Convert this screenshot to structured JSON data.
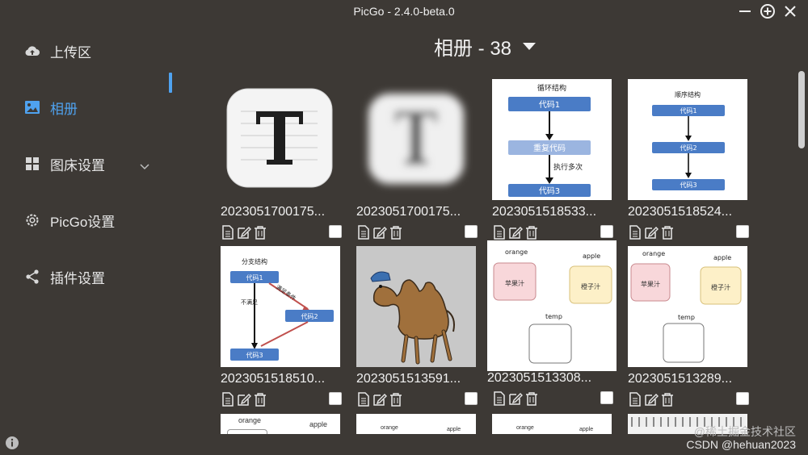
{
  "window": {
    "title": "PicGo - 2.4.0-beta.0"
  },
  "sidebar": {
    "items": [
      {
        "label": "上传区",
        "icon": "upload-cloud-icon"
      },
      {
        "label": "相册",
        "icon": "image-icon",
        "active": true
      },
      {
        "label": "图床设置",
        "icon": "grid-icon"
      },
      {
        "label": "PicGo设置",
        "icon": "gear-icon"
      },
      {
        "label": "插件设置",
        "icon": "share-icon"
      }
    ]
  },
  "album": {
    "title": "相册 - 38"
  },
  "gallery": {
    "items": [
      {
        "filename": "2023051700175...",
        "thumb": "typora-icon-sharp"
      },
      {
        "filename": "2023051700175...",
        "thumb": "typora-icon-blurred"
      },
      {
        "filename": "2023051518533...",
        "thumb": "loop-structure-diagram",
        "texts": [
          "循环结构",
          "代码1",
          "重复代码",
          "执行多次",
          "代码3"
        ]
      },
      {
        "filename": "2023051518524...",
        "thumb": "sequence-structure-diagram",
        "texts": [
          "顺序结构",
          "代码1",
          "代码2",
          "代码3"
        ]
      },
      {
        "filename": "2023051518510...",
        "thumb": "branch-structure-diagram",
        "texts": [
          "分支结构",
          "代码1",
          "满足条件",
          "不满足",
          "代码2",
          "代码3"
        ]
      },
      {
        "filename": "2023051513591...",
        "thumb": "camel-picture"
      },
      {
        "filename": "2023051513308...",
        "thumb": "variable-swap-diagram",
        "texts": [
          "orange",
          "apple",
          "苹果汁",
          "橙子汁",
          "temp"
        ]
      },
      {
        "filename": "2023051513289...",
        "thumb": "variable-swap-diagram",
        "texts": [
          "orange",
          "apple",
          "苹果汁",
          "橙子汁",
          "temp"
        ]
      }
    ],
    "partial_row": [
      {
        "texts": [
          "orange",
          "apple"
        ]
      },
      {
        "texts": [
          "orange",
          "apple"
        ]
      },
      {
        "texts": [
          "orange",
          "apple"
        ]
      },
      {
        "texts": []
      }
    ]
  },
  "watermark": {
    "line1": "@稀土掘金技术社区",
    "line2": "CSDN @hehuan2023"
  },
  "colors": {
    "background": "#3d3935",
    "accent": "#4fa2ef",
    "diagram_blue": "#4a7cc6"
  }
}
